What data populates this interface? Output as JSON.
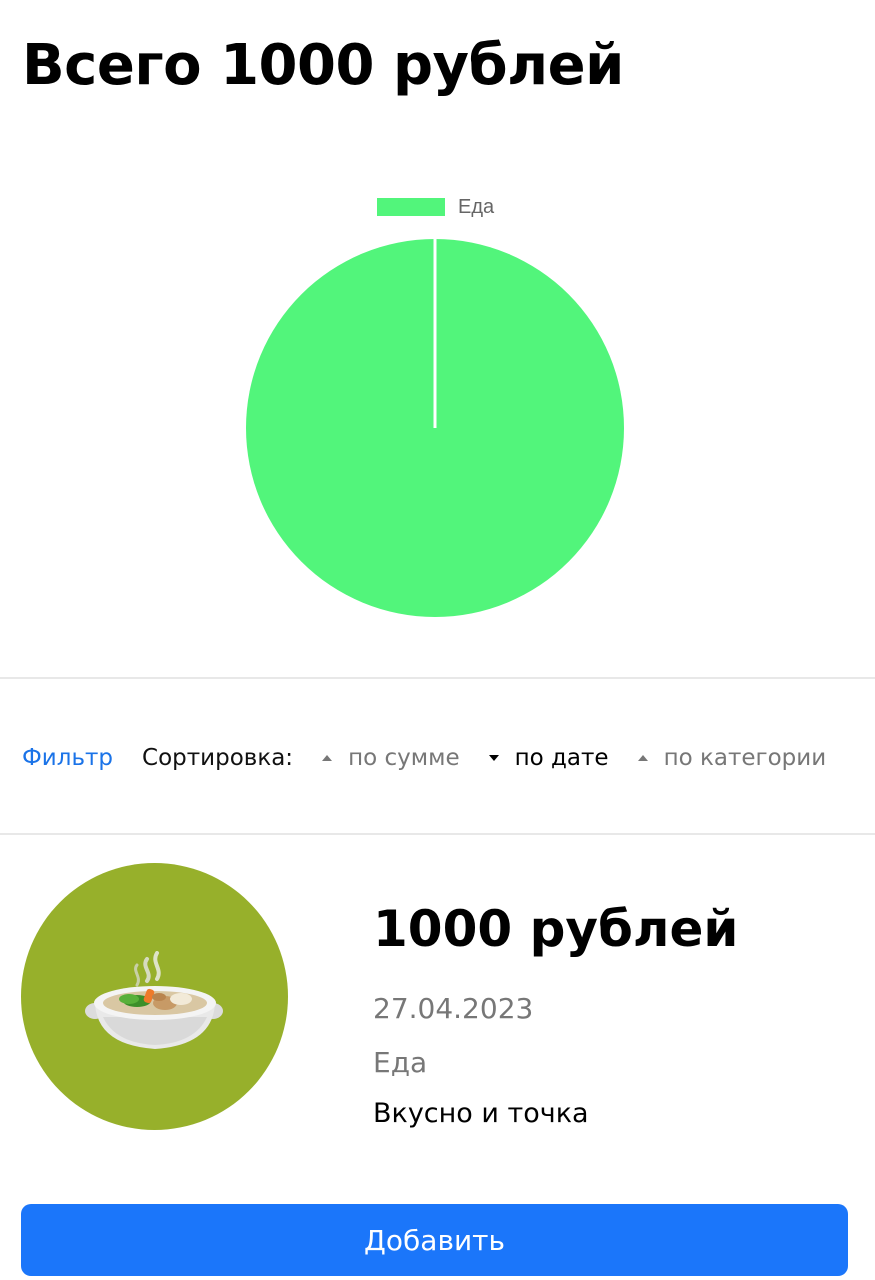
{
  "header": {
    "total_title": "Всего 1000 рублей"
  },
  "chart_data": {
    "type": "pie",
    "categories": [
      "Еда"
    ],
    "values": [
      1000
    ],
    "colors": [
      "#52f57b"
    ],
    "legend_position": "top",
    "legend": [
      "Еда"
    ]
  },
  "toolbar": {
    "filter_label": "Фильтр",
    "sort_label": "Сортировка:",
    "sort_options": [
      {
        "label": "по сумме",
        "direction": "up",
        "active": false
      },
      {
        "label": "по дате",
        "direction": "down",
        "active": true
      },
      {
        "label": "по категории",
        "direction": "up",
        "active": false
      }
    ]
  },
  "expenses": [
    {
      "amount": "1000 рублей",
      "date": "27.04.2023",
      "category": "Еда",
      "comment": "Вкусно и точка",
      "icon": "soup-bowl-icon",
      "circle_color": "#97b02b"
    }
  ],
  "actions": {
    "add_label": "Добавить"
  },
  "colors": {
    "accent": "#1b76fa",
    "link": "#1a73e8",
    "food": "#52f57b"
  }
}
